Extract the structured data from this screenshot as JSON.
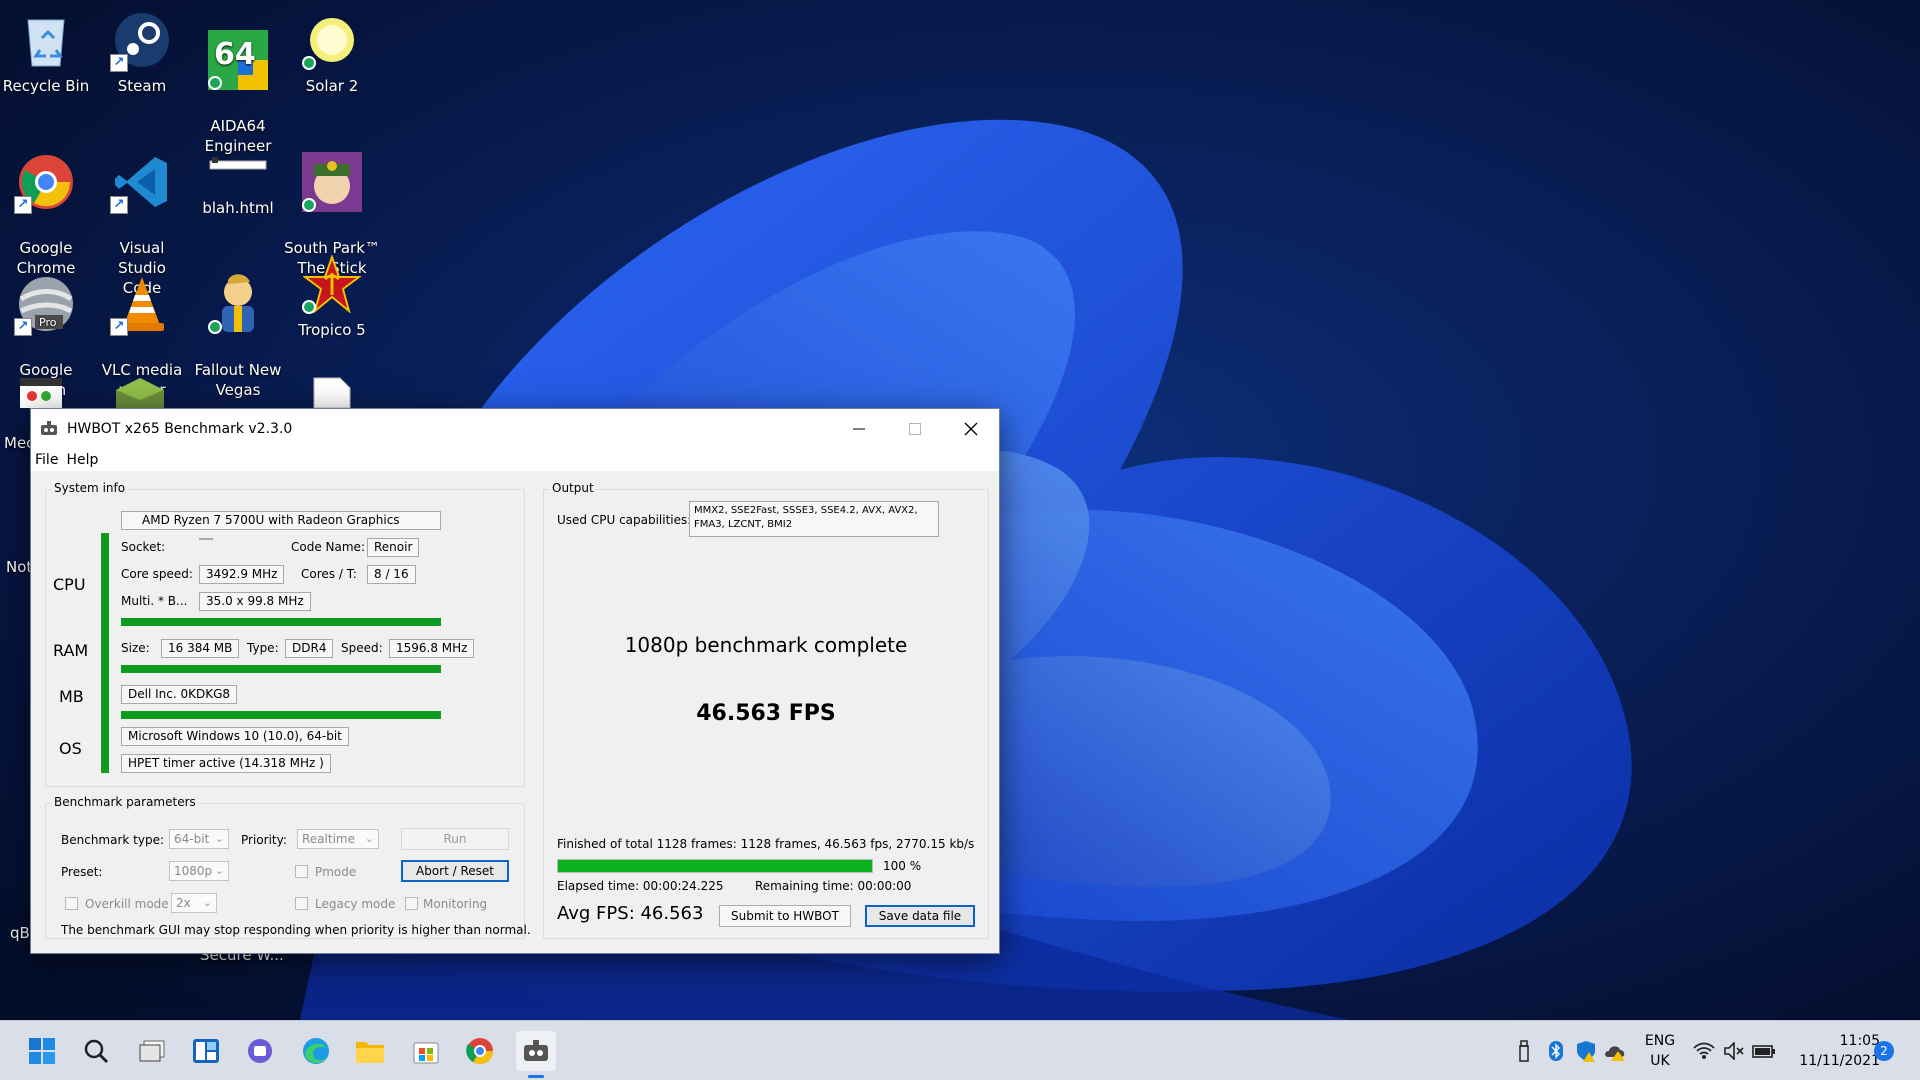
{
  "desktop": {
    "icons": [
      {
        "label": "Recycle Bin"
      },
      {
        "label": "Steam"
      },
      {
        "label": "AIDA64\nEngineer"
      },
      {
        "label": "Solar 2"
      },
      {
        "label": "Google\nChrome"
      },
      {
        "label": "Visual Studio\nCode"
      },
      {
        "label": "blah.html"
      },
      {
        "label": "South Park™\nThe Stick o..."
      },
      {
        "label": "Google Earth\nPro"
      },
      {
        "label": "VLC media\nplayer"
      },
      {
        "label": "Fallout New\nVegas"
      },
      {
        "label": "Tropico 5"
      }
    ],
    "partial_labels": {
      "mec": "Mec",
      "not": "Not",
      "qbi": "qBi",
      "secure": "Secure W..."
    }
  },
  "window": {
    "title": "HWBOT x265 Benchmark v2.3.0",
    "menu": [
      "File",
      "Help"
    ],
    "system_info": {
      "group_title": "System info",
      "cpu_label": "CPU",
      "ram_label": "RAM",
      "mb_label": "MB",
      "os_label": "OS",
      "cpu_name": "AMD Ryzen 7 5700U with Radeon Graphics",
      "socket_label": "Socket:",
      "socket_value": "",
      "code_name_label": "Code Name:",
      "code_name_value": "Renoir",
      "core_speed_label": "Core speed:",
      "core_speed_value": "3492.9 MHz",
      "cores_label": "Cores / T:",
      "cores_value": "8 / 16",
      "multi_label": "Multi. * B...",
      "multi_value": "35.0 x 99.8 MHz",
      "ram_size_label": "Size:",
      "ram_size_value": "16 384 MB",
      "ram_type_label": "Type:",
      "ram_type_value": "DDR4",
      "ram_speed_label": "Speed:",
      "ram_speed_value": "1596.8 MHz",
      "mb_value": "Dell Inc. 0KDKG8",
      "os_value": "Microsoft Windows 10 (10.0), 64-bit",
      "timer_value": "HPET timer active (14.318 MHz )"
    },
    "params": {
      "group_title": "Benchmark parameters",
      "type_label": "Benchmark type:",
      "type_value": "64-bit",
      "priority_label": "Priority:",
      "priority_value": "Realtime",
      "run_label": "Run",
      "preset_label": "Preset:",
      "preset_value": "1080p",
      "pmode_label": "Pmode",
      "abort_label": "Abort / Reset",
      "overkill_label": "Overkill mode",
      "overkill_value": "2x",
      "legacy_label": "Legacy mode",
      "monitoring_label": "Monitoring",
      "warning": "The benchmark GUI may stop responding when priority is higher than normal."
    },
    "output": {
      "group_title": "Output",
      "caps_label": "Used CPU capabilities:",
      "caps_value": "MMX2, SSE2Fast, SSSE3, SSE4.2, AVX, AVX2, FMA3, LZCNT, BMI2",
      "status": "1080p benchmark complete",
      "fps_big": "46.563 FPS",
      "finished_text": "Finished of total 1128 frames: 1128 frames, 46.563 fps,  2770.15 kb/s",
      "progress": 1.0,
      "progress_text": "100 %",
      "elapsed": "Elapsed time: 00:00:24.225",
      "remaining": "Remaining time: 00:00:00",
      "avg_fps": "Avg FPS: 46.563",
      "submit_label": "Submit to HWBOT",
      "save_label": "Save data file"
    }
  },
  "taskbar": {
    "lang_top": "ENG",
    "lang_bottom": "UK",
    "time": "11:05",
    "date": "11/11/2021",
    "notifications": "2"
  }
}
